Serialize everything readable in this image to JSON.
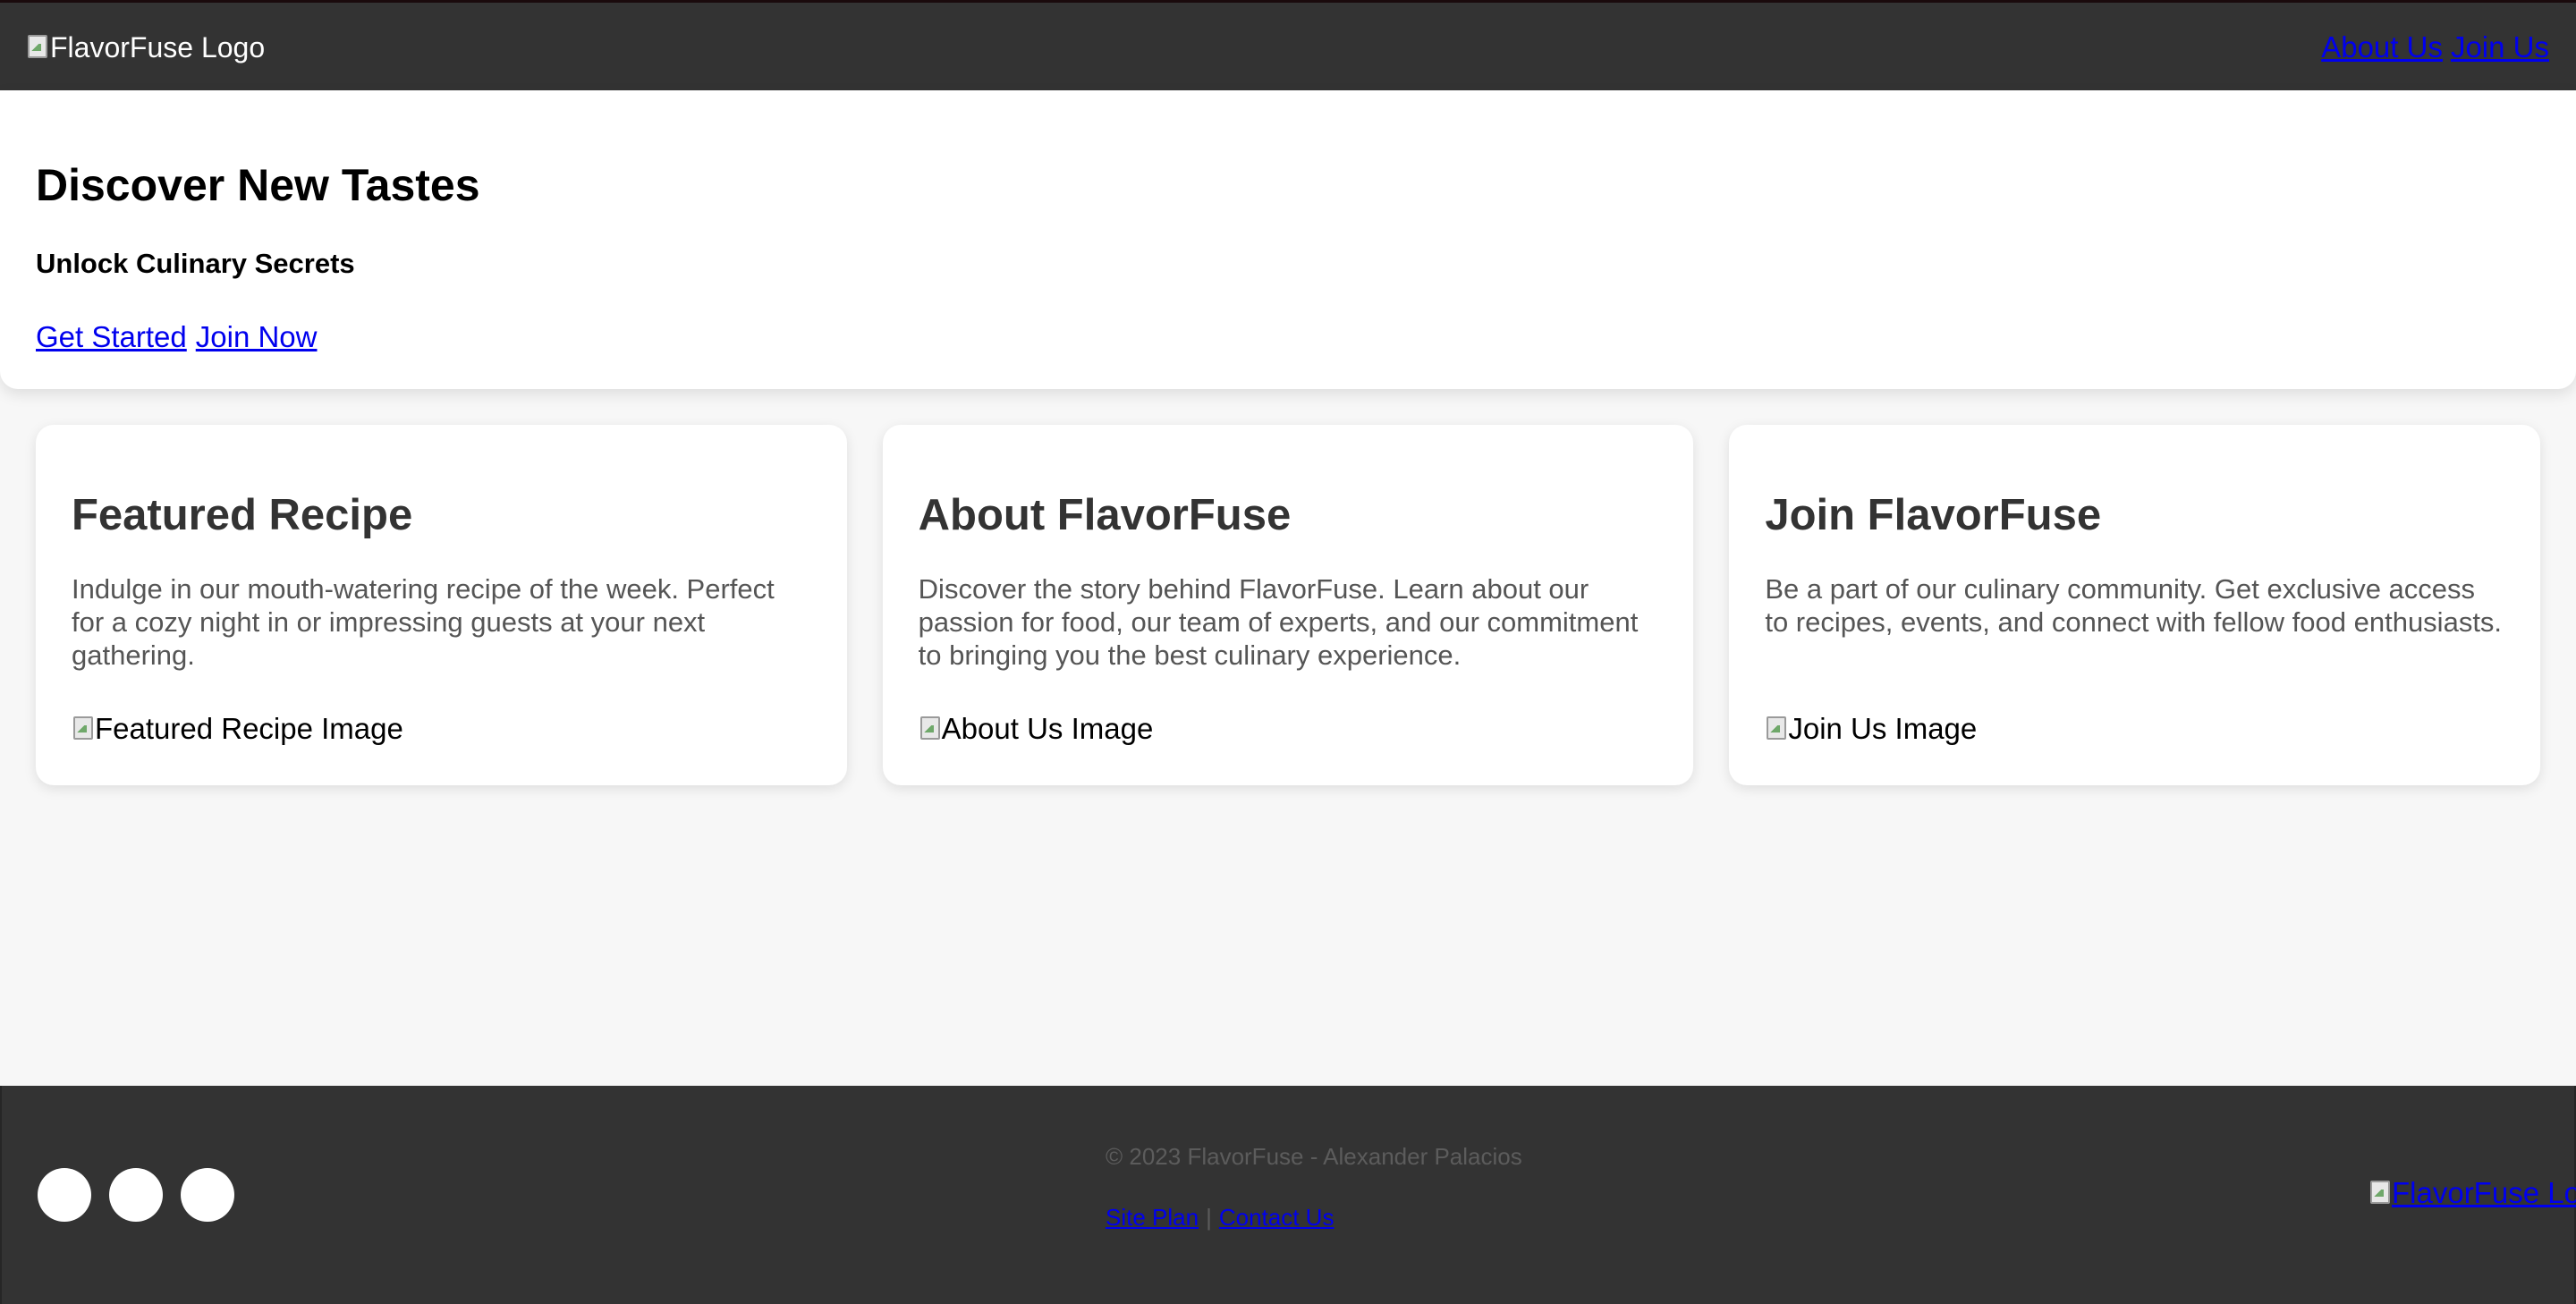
{
  "header": {
    "logo_alt": "FlavorFuse Logo",
    "nav": [
      {
        "label": "About Us"
      },
      {
        "label": "Join Us"
      }
    ]
  },
  "hero": {
    "title": "Discover New Tastes",
    "subtitle": "Unlock Culinary Secrets",
    "cta": [
      {
        "label": "Get Started"
      },
      {
        "label": "Join Now"
      }
    ]
  },
  "cards": [
    {
      "title": "Featured Recipe",
      "text": "Indulge in our mouth-watering recipe of the week. Perfect for a cozy night in or impressing guests at your next gathering.",
      "image_alt": "Featured Recipe Image"
    },
    {
      "title": "About FlavorFuse",
      "text": "Discover the story behind FlavorFuse. Learn about our passion for food, our team of experts, and our commitment to bringing you the best culinary experience.",
      "image_alt": "About Us Image"
    },
    {
      "title": "Join FlavorFuse",
      "text": "Be a part of our culinary community. Get exclusive access to recipes, events, and connect with fellow food enthusiasts.",
      "image_alt": "Join Us Image"
    }
  ],
  "footer": {
    "copyright": "© 2023 FlavorFuse - Alexander Palacios",
    "links": [
      {
        "label": "Site Plan"
      },
      {
        "label": "Contact Us"
      }
    ],
    "separator": "|",
    "logo_alt": "FlavorFuse Logo",
    "social_count": 3
  },
  "colors": {
    "header_bg": "#333333",
    "page_bg": "#f7f7f7",
    "card_bg": "#ffffff",
    "link": "#0000ee",
    "heading": "#333333",
    "body_text": "#555555"
  }
}
